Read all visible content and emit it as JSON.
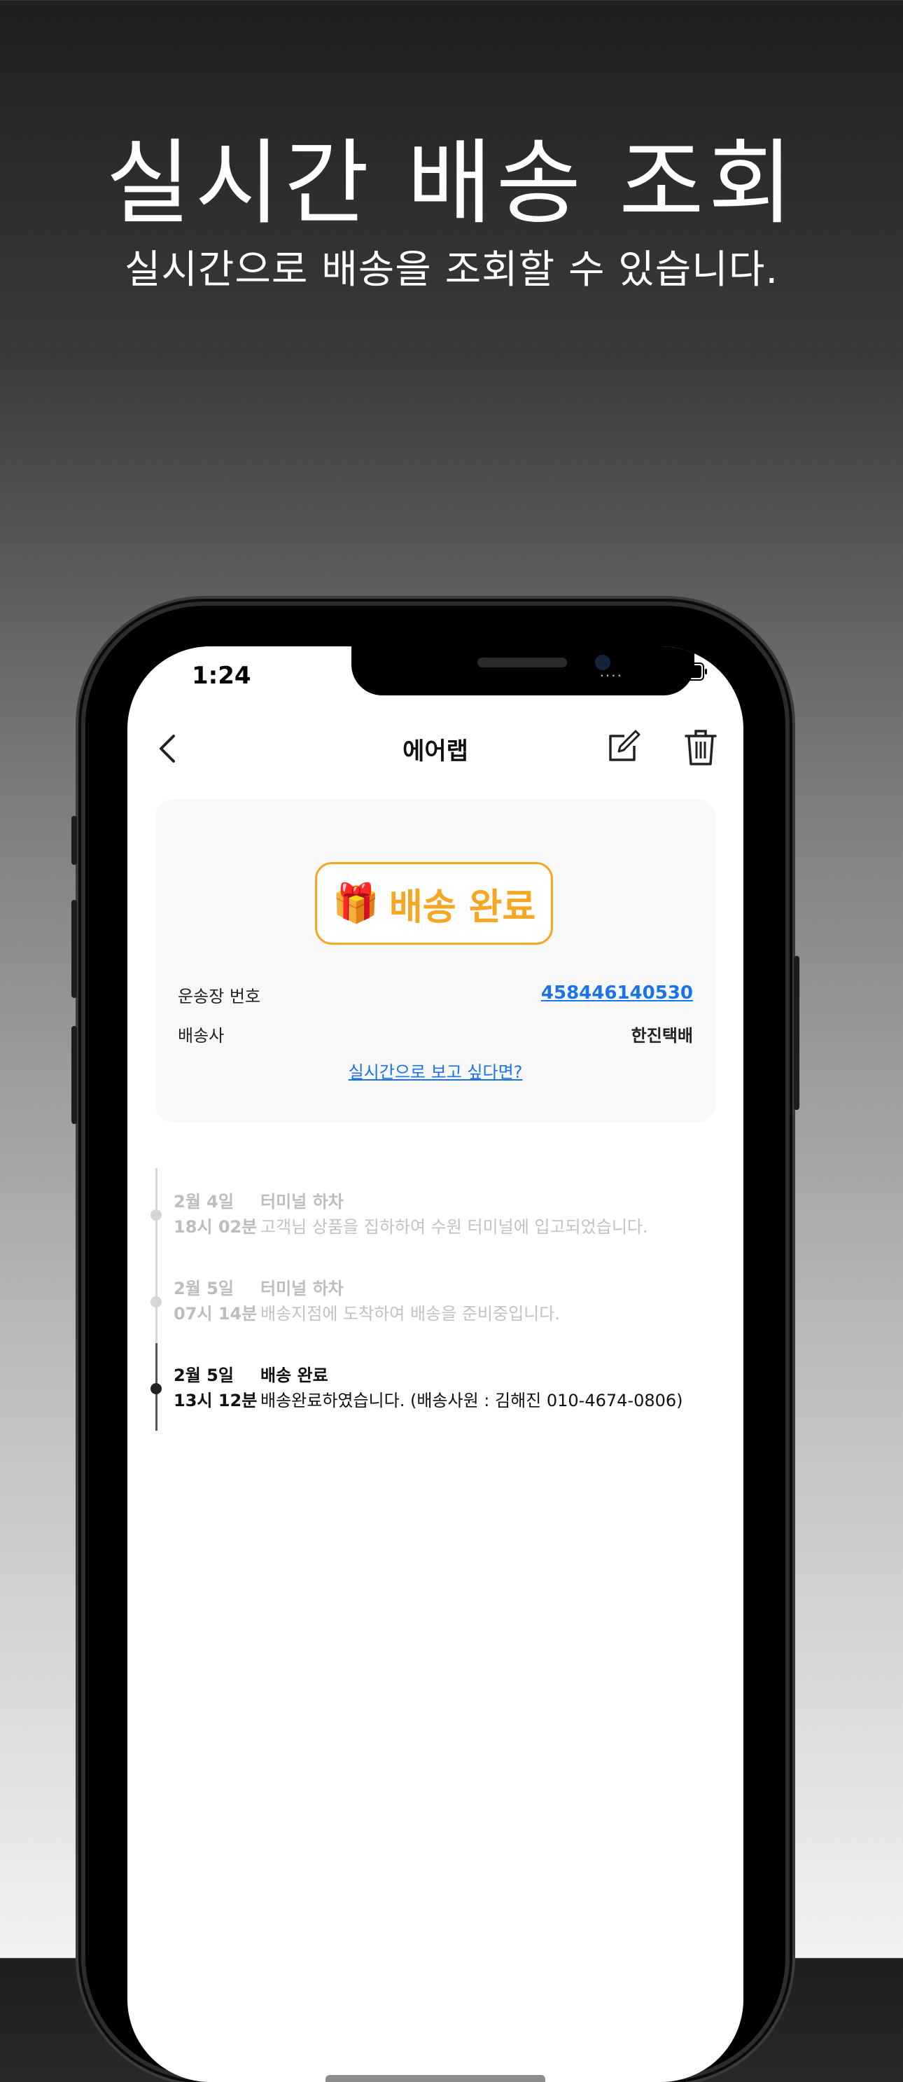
{
  "promo": {
    "title": "실시간 배송 조회",
    "subtitle": "실시간으로 배송을 조회할 수 있습니다."
  },
  "status_bar": {
    "time": "1:24",
    "dots": "....",
    "icons": [
      "wifi-icon",
      "battery-icon"
    ]
  },
  "nav": {
    "title": "에어랩",
    "icons": [
      "chevron-left-icon",
      "edit-icon",
      "trash-icon"
    ]
  },
  "card": {
    "status_emoji": "🎁",
    "status_label": "배송 완료",
    "status_color": "#f5a623",
    "tracking_label": "운송장 번호",
    "tracking_number": "458446140530",
    "carrier_label": "배송사",
    "carrier_value": "한진택배",
    "live_link": "실시간으로 보고 싶다면?",
    "link_color": "#1a73e8"
  },
  "timeline": [
    {
      "date": "2월 4일",
      "time": "18시 02분",
      "stage": "터미널 하차",
      "description": "고객님 상품을 집하하여 수원 터미널에 입고되었습니다."
    },
    {
      "date": "2월 5일",
      "time": "07시 14분",
      "stage": "터미널 하차",
      "description": "배송지점에 도착하여 배송을 준비중입니다."
    },
    {
      "date": "2월 5일",
      "time": "13시 12분",
      "stage": "배송 완료",
      "description": "배송완료하였습니다. (배송사원 : 김해진 010-4674-0806)"
    }
  ]
}
